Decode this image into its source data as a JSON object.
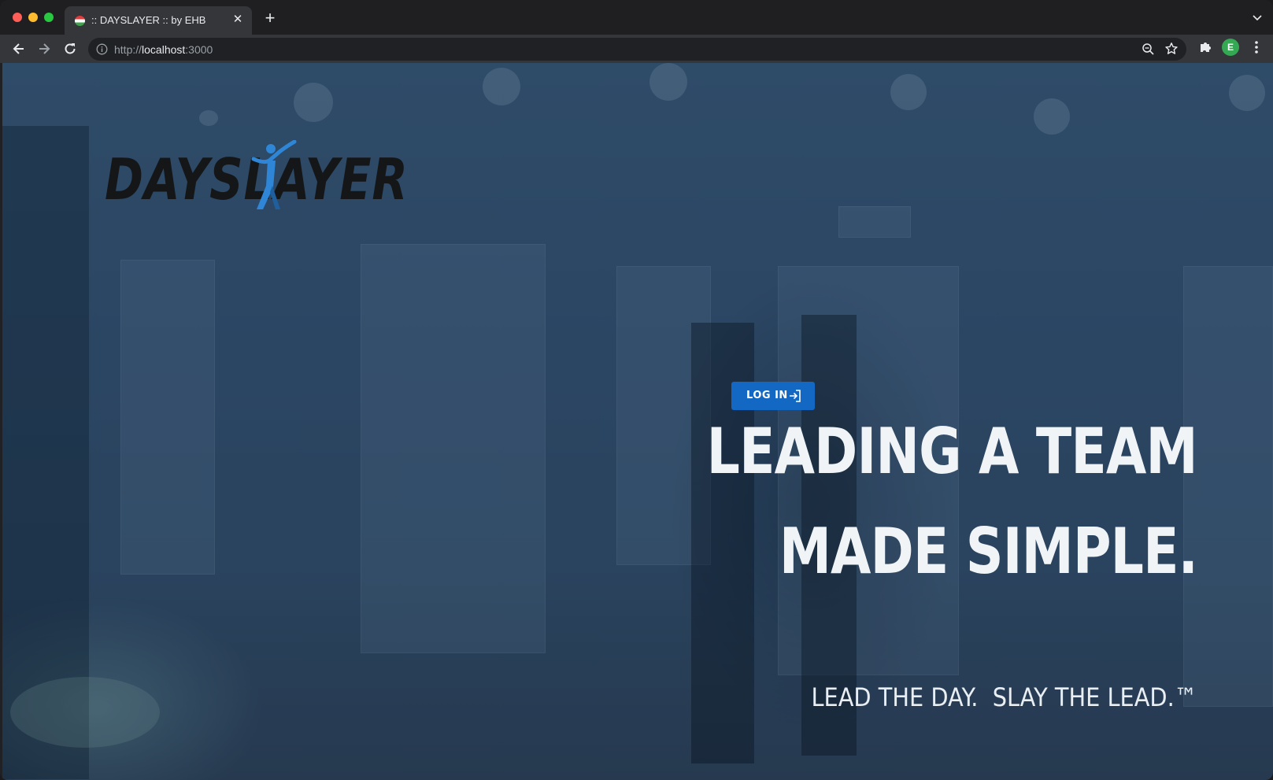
{
  "browser": {
    "tab": {
      "title": ":: DAYSLAYER :: by EHB"
    },
    "omnibox": {
      "scheme": "http://",
      "host": "localhost",
      "port": ":3000"
    },
    "profile": {
      "initial": "E"
    }
  },
  "page": {
    "logo": {
      "text": "DAYSLAYER"
    },
    "login_button": {
      "label": "LOG IN"
    },
    "headline": {
      "line1": "LEADING A TEAM",
      "line2": "MADE SIMPLE."
    },
    "tagline": "LEAD THE DAY.  SLAY THE LEAD.™"
  },
  "colors": {
    "accent": "#1368c4",
    "logo_blue": "#2f86d6",
    "background": "#2e4b68"
  },
  "icons": [
    "close-icon",
    "plus-icon",
    "chevron-down-icon",
    "back-arrow-icon",
    "forward-arrow-icon",
    "reload-icon",
    "info-icon",
    "zoom-icon",
    "star-icon",
    "puzzle-icon",
    "kebab-menu-icon",
    "login-arrow-icon"
  ]
}
